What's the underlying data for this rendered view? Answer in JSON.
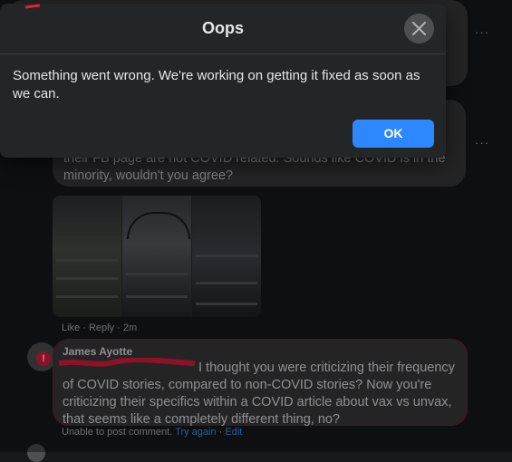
{
  "dialog": {
    "title": "Oops",
    "message": "Something went wrong. We're working on getting it fixed as soon as we can.",
    "ok_label": "OK",
    "close_icon": "close-icon"
  },
  "comments": {
    "partial_text": "their FB page are not COVID related. Sounds like COVID is in the minority, wouldn't you agree?",
    "more_label": "···",
    "actions": {
      "like": "Like",
      "reply": "Reply",
      "time": "2m",
      "sep": "·"
    }
  },
  "failed_comment": {
    "author": "James Ayotte",
    "text": "I thought you were criticizing their frequency of COVID stories, compared to non-COVID stories? Now you're criticizing their specifics within a COVID article about vax vs unvax, that seems like a completely different thing, no?",
    "status": "Unable to post comment.",
    "try_again": "Try again",
    "edit": "Edit",
    "sep": "·",
    "warn_icon": "!"
  },
  "colors": {
    "background": "#18191a",
    "bubble": "#3a3b3c",
    "dialog": "#242526",
    "primary": "#2d88ff",
    "error_border": "#7a2330",
    "link": "#4599ff"
  }
}
